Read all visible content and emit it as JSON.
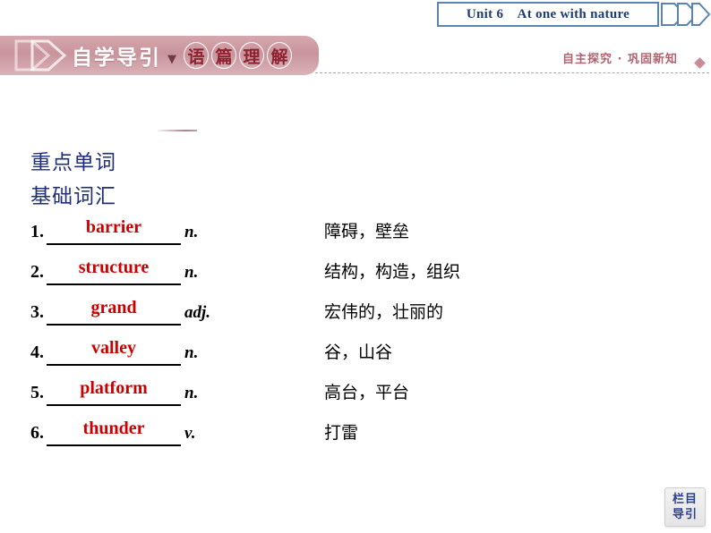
{
  "unit_banner": {
    "title": "Unit 6 At one with nature",
    "border_color": "#5b84b1",
    "text_color": "#1f3a7a",
    "chevron_icon": "double-chevron-right-icon"
  },
  "section_header": {
    "left_title_plain": "自学导引",
    "separator": "▼",
    "left_title_circled": [
      "语",
      "篇",
      "理",
      "解"
    ],
    "banner_color": "#c9949c",
    "chevron_icon": "double-chevron-right-icon",
    "right_subtitle": "自主探究 · 巩固新知",
    "right_subtitle_color": "#b0636f",
    "diamond_icon": "diamond-marker-icon"
  },
  "content": {
    "heading_1": "重点单词",
    "heading_2": "基础词汇",
    "heading_color": "#1f2f7a",
    "answer_color": "#cc0000",
    "items": [
      {
        "num": "1.",
        "word": "barrier",
        "pos": "n.",
        "definition": "障碍，壁垒"
      },
      {
        "num": "2.",
        "word": "structure",
        "pos": "n.",
        "definition": "结构，构造，组织"
      },
      {
        "num": "3.",
        "word": "grand",
        "pos": "adj.",
        "definition": "宏伟的，壮丽的"
      },
      {
        "num": "4.",
        "word": "valley",
        "pos": "n.",
        "definition": "谷，山谷"
      },
      {
        "num": "5.",
        "word": "platform",
        "pos": "n.",
        "definition": "高台，平台"
      },
      {
        "num": "6.",
        "word": "thunder",
        "pos": "v.",
        "definition": "打雷"
      }
    ]
  },
  "nav_button": {
    "line1": "栏目",
    "line2": "导引",
    "text_color": "#2b3f8f"
  }
}
